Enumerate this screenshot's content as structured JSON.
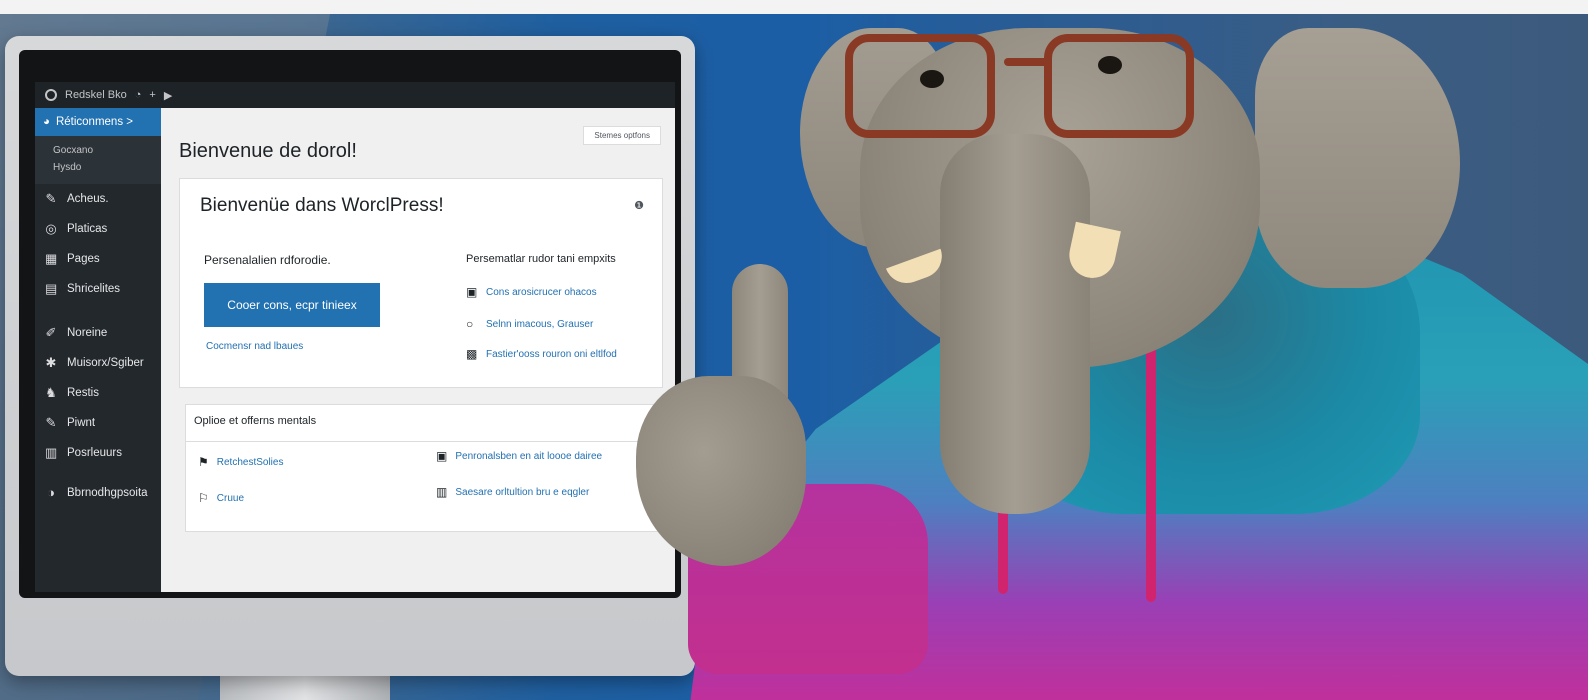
{
  "admin_bar": {
    "site_name": "Redskel Bko",
    "icons": [
      "wordpress-logo-icon",
      "comment-icon",
      "plus-icon",
      "play-icon"
    ]
  },
  "sidebar": {
    "active_item": "Réticonmens >",
    "sub_items": [
      "Gocxano",
      "Hysdo"
    ],
    "items": [
      {
        "icon": "pin-icon",
        "label": "Acheus."
      },
      {
        "icon": "media-icon",
        "label": "Platicas"
      },
      {
        "icon": "pages-icon",
        "label": "Pages"
      },
      {
        "icon": "comments-icon",
        "label": "Shricelites"
      },
      {
        "icon": "appearance-icon",
        "label": "Noreine"
      },
      {
        "icon": "plugins-icon",
        "label": "Muisorx/Sgiber"
      },
      {
        "icon": "users-icon",
        "label": "Restis"
      },
      {
        "icon": "tools-icon",
        "label": "Piwnt"
      },
      {
        "icon": "settings-icon",
        "label": "Posrleuurs"
      },
      {
        "icon": "collapse-icon",
        "label": "Bbrnodhgpsoita"
      }
    ]
  },
  "content": {
    "page_title": "Bienvenue de dorol!",
    "screen_options": "Stemes optfons",
    "welcome_panel": {
      "heading": "Bienvenüe dans WorclPress!",
      "help_icon": "help-icon",
      "col1_heading": "Persenalalien rdforodie.",
      "cta_button": "Cooer cons, ecpr tinieex",
      "col1_link": "Cocmensr nad lbaues",
      "col2_heading": "Persematlar rudor tani empxits",
      "col2_links": [
        {
          "icon": "document-icon",
          "label": "Cons arosicrucer ohacos"
        },
        {
          "icon": "circle-icon",
          "label": "Selnn imacous, Grauser"
        },
        {
          "icon": "cart-icon",
          "label": "Fastier'ooss rouron oni eltlfod"
        }
      ]
    },
    "secondary_panel": {
      "title": "Oplioe et offerns mentals",
      "links": [
        {
          "icon": "flag-icon",
          "label": "RetchestSolies"
        },
        {
          "icon": "flag-icon",
          "label": "Cruue"
        },
        {
          "icon": "document-icon",
          "label": "Penronalsben en ait loooe dairee"
        },
        {
          "icon": "document-icon",
          "label": "Saesare orltultion bru e eqgler"
        }
      ]
    }
  },
  "colors": {
    "wp_blue": "#2271b1",
    "admin_dark": "#1d2327",
    "hoodie_teal": "#1f93b0",
    "hoodie_magenta": "#c22f9a",
    "cord_pink": "#d1246f",
    "glasses_frame": "#8a3a24"
  }
}
